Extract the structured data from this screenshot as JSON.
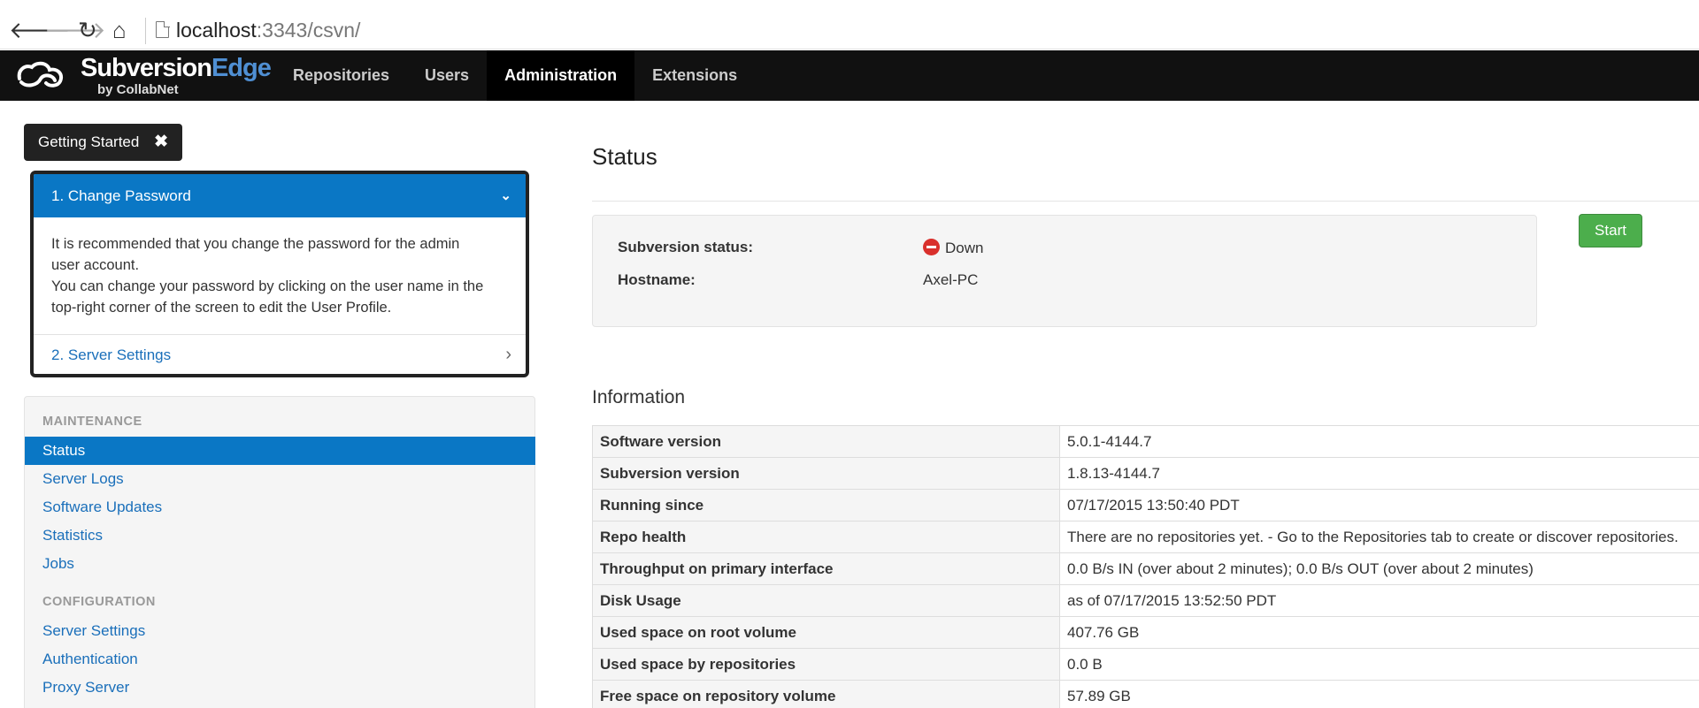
{
  "browser": {
    "url_host": "localhost",
    "url_rest": ":3343/csvn/"
  },
  "app": {
    "logo_main": "Subversion",
    "logo_accent": "Edge",
    "logo_sub": "by CollabNet",
    "nav": [
      {
        "label": "Repositories",
        "active": false
      },
      {
        "label": "Users",
        "active": false
      },
      {
        "label": "Administration",
        "active": true
      },
      {
        "label": "Extensions",
        "active": false
      }
    ]
  },
  "getting_started": {
    "button_label": "Getting Started",
    "close_glyph": "✖",
    "step1_title": "1. Change Password",
    "step1_line1": "It is recommended that you change the password for the admin",
    "step1_line2": "user account.",
    "step1_line3": "You can change your password by clicking on the user name in the",
    "step1_line4": "top-right corner of the screen to edit the User Profile.",
    "step2_title": "2. Server Settings"
  },
  "sidebar": {
    "maintenance_header": "MAINTENANCE",
    "maintenance_items": [
      "Status",
      "Server Logs",
      "Software Updates",
      "Statistics",
      "Jobs"
    ],
    "configuration_header": "CONFIGURATION",
    "configuration_items": [
      "Server Settings",
      "Authentication",
      "Proxy Server"
    ]
  },
  "main": {
    "title": "Status",
    "subversion_status_label": "Subversion status:",
    "subversion_status_value": "Down",
    "hostname_label": "Hostname:",
    "hostname_value": "Axel-PC",
    "start_button": "Start",
    "info_title": "Information",
    "info_rows": [
      {
        "key": "Software version",
        "value": "5.0.1-4144.7"
      },
      {
        "key": "Subversion version",
        "value": "1.8.13-4144.7"
      },
      {
        "key": "Running since",
        "value": "07/17/2015 13:50:40 PDT"
      },
      {
        "key": "Repo health",
        "value": "There are no repositories yet. - Go to the Repositories tab to create or discover repositories."
      },
      {
        "key": "Throughput on primary interface",
        "value": "0.0 B/s IN (over about 2 minutes); 0.0 B/s OUT (over about 2 minutes)"
      },
      {
        "key": "Disk Usage",
        "value": "as of 07/17/2015 13:52:50 PDT"
      },
      {
        "key": "Used space on root volume",
        "value": "407.76 GB"
      },
      {
        "key": "Used space by repositories",
        "value": "0.0 B"
      },
      {
        "key": "Free space on repository volume",
        "value": "57.89 GB"
      }
    ]
  },
  "colors": {
    "accent_blue": "#0a77c5",
    "link_blue": "#1a6fba",
    "start_green": "#4cae4c",
    "status_down_red": "#d9302c",
    "header_black": "#111111"
  }
}
